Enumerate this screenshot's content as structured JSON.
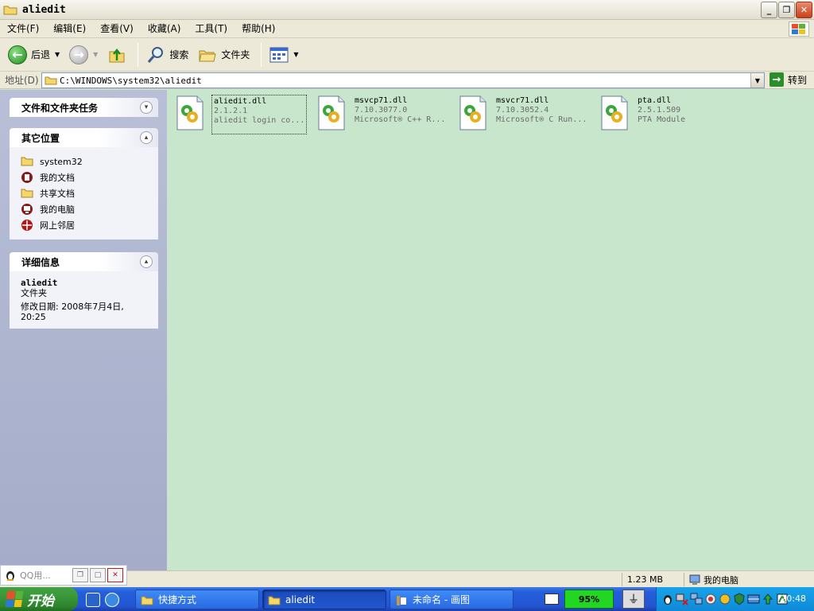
{
  "window": {
    "title": "aliedit",
    "buttons": {
      "minimize": "_",
      "maximize": "❐",
      "close": "✕"
    }
  },
  "menu": [
    {
      "label": "文件(F)"
    },
    {
      "label": "编辑(E)"
    },
    {
      "label": "查看(V)"
    },
    {
      "label": "收藏(A)"
    },
    {
      "label": "工具(T)"
    },
    {
      "label": "帮助(H)"
    }
  ],
  "toolbar": {
    "back_label": "后退",
    "search_label": "搜索",
    "folders_label": "文件夹"
  },
  "address": {
    "label": "地址(D)",
    "value": "C:\\WINDOWS\\system32\\aliedit",
    "go_label": "转到"
  },
  "task_pane": {
    "file_tasks": {
      "title": "文件和文件夹任务"
    },
    "other_places": {
      "title": "其它位置",
      "items": [
        {
          "label": "system32",
          "icon": "folder-icon"
        },
        {
          "label": "我的文档",
          "icon": "my-documents-icon"
        },
        {
          "label": "共享文档",
          "icon": "folder-icon"
        },
        {
          "label": "我的电脑",
          "icon": "my-computer-icon"
        },
        {
          "label": "网上邻居",
          "icon": "network-icon"
        }
      ]
    },
    "details": {
      "title": "详细信息",
      "name": "aliedit",
      "type": "文件夹",
      "modified": "修改日期: 2008年7月4日, 20:25"
    }
  },
  "files": [
    {
      "name": "aliedit.dll",
      "version": "2.1.2.1",
      "desc": "aliedit login co...",
      "selected": true
    },
    {
      "name": "msvcp71.dll",
      "version": "7.10.3077.0",
      "desc": "Microsoft® C++ R...",
      "selected": false
    },
    {
      "name": "msvcr71.dll",
      "version": "7.10.3052.4",
      "desc": "Microsoft® C Run...",
      "selected": false
    },
    {
      "name": "pta.dll",
      "version": "2.5.1.509",
      "desc": "PTA Module",
      "selected": false
    }
  ],
  "statusbar": {
    "size": "1.23 MB",
    "location": "我的电脑"
  },
  "qq_float": {
    "label": "QQ用..."
  },
  "taskbar": {
    "start_label": "开始",
    "tasks": [
      {
        "label": "快捷方式"
      },
      {
        "label": "aliedit"
      },
      {
        "label": "未命名 - 画图"
      }
    ],
    "battery": "95%",
    "clock": "20:48"
  },
  "colors": {
    "content_bg": "#c8e6cc",
    "taskbar": "#245edb",
    "start": "#3c9a3c",
    "tray": "#0f8ad8"
  }
}
